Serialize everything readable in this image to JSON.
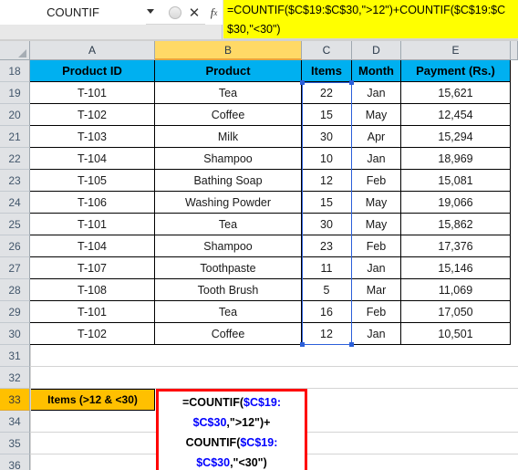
{
  "formula_bar": {
    "name_box_value": "COUNTIF",
    "dropdown_icon": "chevron-down-icon",
    "insert_function_icon": "fx",
    "cancel_icon": "✕",
    "enter_icon": "✓",
    "formula_text": "=COUNTIF($C$19:$C$30,\">12\")+COUNTIF($C$19:$C$30,\"<30\")",
    "background_color": "#ffff00"
  },
  "grid": {
    "column_headers": [
      "A",
      "B",
      "C",
      "D",
      "E"
    ],
    "selected_column": "B",
    "row_headers": [
      "18",
      "19",
      "20",
      "21",
      "22",
      "23",
      "24",
      "25",
      "26",
      "27",
      "28",
      "29",
      "30",
      "31",
      "32",
      "33",
      "34",
      "35",
      "36"
    ],
    "selected_row": "33",
    "header_fill": "#00b0f0",
    "selected_header_fill": "#ffc000",
    "table_headers": [
      "Product ID",
      "Product",
      "Items",
      "Month",
      "Payment (Rs.)"
    ],
    "rows": [
      {
        "row": "19",
        "product_id": "T-101",
        "product": "Tea",
        "items": "22",
        "month": "Jan",
        "payment": "15,621"
      },
      {
        "row": "20",
        "product_id": "T-102",
        "product": "Coffee",
        "items": "15",
        "month": "May",
        "payment": "12,454"
      },
      {
        "row": "21",
        "product_id": "T-103",
        "product": "Milk",
        "items": "30",
        "month": "Apr",
        "payment": "15,294"
      },
      {
        "row": "22",
        "product_id": "T-104",
        "product": "Shampoo",
        "items": "10",
        "month": "Jan",
        "payment": "18,969"
      },
      {
        "row": "23",
        "product_id": "T-105",
        "product": "Bathing Soap",
        "items": "12",
        "month": "Feb",
        "payment": "15,081"
      },
      {
        "row": "24",
        "product_id": "T-106",
        "product": "Washing Powder",
        "items": "15",
        "month": "May",
        "payment": "19,066"
      },
      {
        "row": "25",
        "product_id": "T-101",
        "product": "Tea",
        "items": "30",
        "month": "May",
        "payment": "15,862"
      },
      {
        "row": "26",
        "product_id": "T-104",
        "product": "Shampoo",
        "items": "23",
        "month": "Feb",
        "payment": "17,376"
      },
      {
        "row": "27",
        "product_id": "T-107",
        "product": "Toothpaste",
        "items": "11",
        "month": "Jan",
        "payment": "15,146"
      },
      {
        "row": "28",
        "product_id": "T-108",
        "product": "Tooth Brush",
        "items": "5",
        "month": "Mar",
        "payment": "11,069"
      },
      {
        "row": "29",
        "product_id": "T-101",
        "product": "Tea",
        "items": "16",
        "month": "Feb",
        "payment": "17,050"
      },
      {
        "row": "30",
        "product_id": "T-102",
        "product": "Coffee",
        "items": "12",
        "month": "Jan",
        "payment": "10,501"
      }
    ],
    "selection_range": "C19:C30",
    "selection_color": "#2b5fd9"
  },
  "result_area": {
    "label": "Items (>12 & <30)",
    "label_fill": "#ffc000",
    "callout_border_color": "#ff0000",
    "formula_lines": [
      [
        {
          "t": "=COUNTIF(",
          "ref": false
        },
        {
          "t": "$C$19:",
          "ref": true
        }
      ],
      [
        {
          "t": "$C$30",
          "ref": true
        },
        {
          "t": ",\">12\")+",
          "ref": false
        }
      ],
      [
        {
          "t": "COUNTIF(",
          "ref": false
        },
        {
          "t": "$C$19:",
          "ref": true
        }
      ],
      [
        {
          "t": "$C$30",
          "ref": true
        },
        {
          "t": ",\"<30\")",
          "ref": false
        }
      ]
    ]
  }
}
